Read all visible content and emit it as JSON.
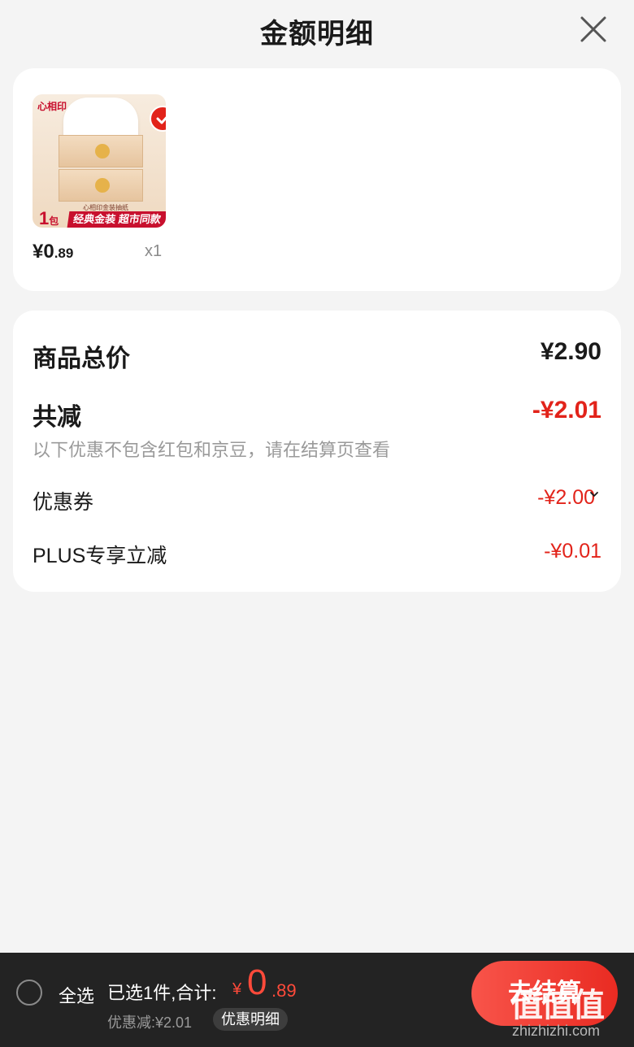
{
  "header": {
    "title": "金额明细",
    "close_icon": "close-icon"
  },
  "product": {
    "image_brand": "心相印",
    "image_caption": "心相印金装抽纸",
    "image_pack_count": "1",
    "image_pack_unit": "包",
    "image_promo": "经典金装 超市同款",
    "selected": true,
    "price_yen": "¥0",
    "price_decimal": ".89",
    "quantity": "x1"
  },
  "summary": {
    "total_label": "商品总价",
    "total_value": "¥2.90",
    "reduce_label": "共减",
    "reduce_value": "-¥2.01",
    "reduce_note": "以下优惠不包含红包和京豆，请在结算页查看",
    "coupon_label": "优惠券",
    "coupon_value": "-¥2.00",
    "plus_label": "PLUS专享立减",
    "plus_value": "-¥0.01"
  },
  "footer": {
    "select_all_label": "全选",
    "selected_summary": "已选1件,合计:",
    "total_yen": "¥",
    "total_int": "0",
    "total_dec": ".89",
    "discount_text": "优惠减:¥2.01",
    "detail_button": "优惠明细",
    "checkout_button": "去结算"
  },
  "watermark": {
    "text": "值值值",
    "url": "zhizhizhi.com"
  },
  "colors": {
    "accent": "#e2231a",
    "footer_bg": "#232323",
    "page_bg": "#f4f4f4"
  }
}
